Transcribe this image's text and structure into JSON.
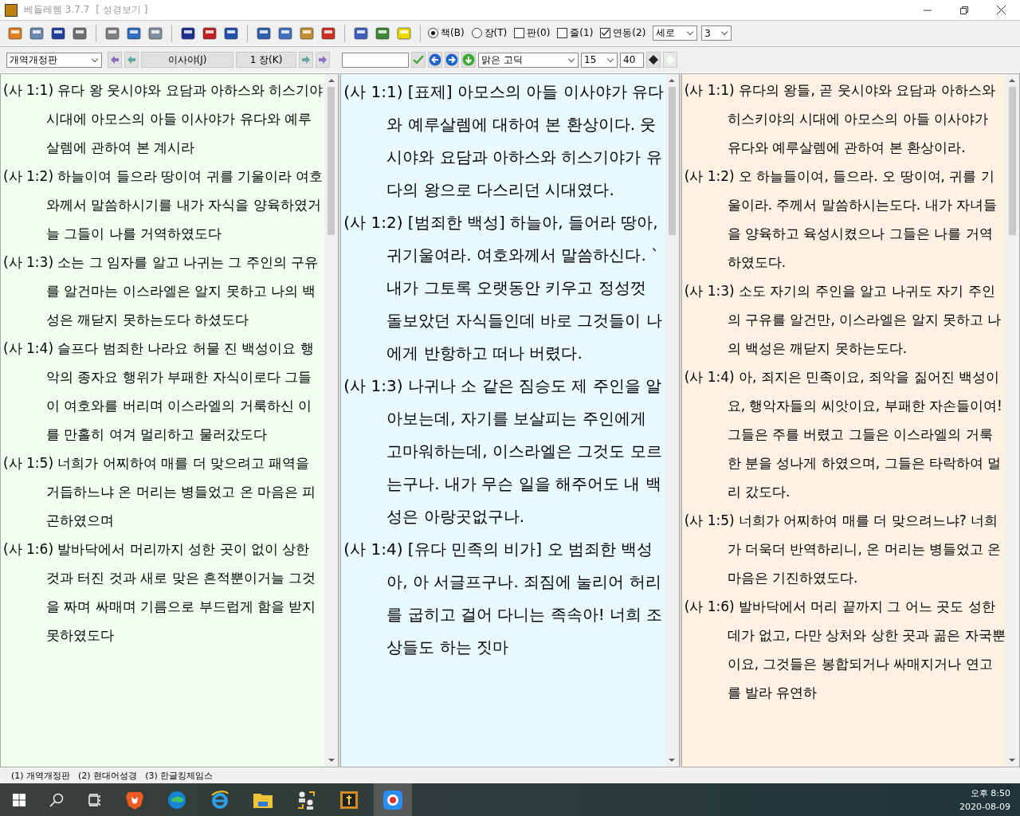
{
  "window": {
    "title": "베들레헴 3.7.7",
    "subtitle": "[ 성경보기 ]"
  },
  "toolbar": {
    "options": [
      {
        "kind": "radio",
        "label": "책(B)",
        "selected": true
      },
      {
        "kind": "radio",
        "label": "장(T)",
        "selected": false
      },
      {
        "kind": "checkbox",
        "label": "판(0)",
        "checked": false
      },
      {
        "kind": "checkbox",
        "label": "줄(1)",
        "checked": false
      },
      {
        "kind": "checkbox",
        "label": "연동(2)",
        "checked": true
      }
    ],
    "layout_select": "세로",
    "count_select": "3"
  },
  "navbar": {
    "version_select": "개역개정판",
    "book_button": "이사야(J)",
    "chapter_button": "1 장(K)",
    "font_select": "맑은 고딕",
    "size_select": "15",
    "width_value": "40"
  },
  "panes": [
    {
      "verses": [
        {
          "ref": "(사 1:1)",
          "text": "유다 왕 웃시야와 요담과 아하스와 히스기야 시대에 아모스의 아들 이사야가 유다와 예루살렘에 관하여 본 계시라"
        },
        {
          "ref": "(사 1:2)",
          "text": "하늘이여 들으라 땅이여 귀를 기울이라 여호와께서 말씀하시기를 내가 자식을 양육하였거늘 그들이 나를 거역하였도다"
        },
        {
          "ref": "(사 1:3)",
          "text": "소는 그 임자를 알고 나귀는 그 주인의 구유를 알건마는 이스라엘은 알지 못하고 나의 백성은 깨닫지 못하는도다 하셨도다"
        },
        {
          "ref": "(사 1:4)",
          "text": "슬프다 범죄한 나라요 허물 진 백성이요 행악의 종자요 행위가 부패한 자식이로다 그들이 여호와를 버리며 이스라엘의 거룩하신 이를 만홀히 여겨 멀리하고 물러갔도다"
        },
        {
          "ref": "(사 1:5)",
          "text": "너희가 어찌하여 매를 더 맞으려고 패역을 거듭하느냐 온 머리는 병들었고 온 마음은 피곤하였으며"
        },
        {
          "ref": "(사 1:6)",
          "text": "발바닥에서 머리까지 성한 곳이 없이 상한 것과 터진 것과 새로 맞은 흔적뿐이거늘 그것을 짜며 싸매며 기름으로 부드럽게 함을 받지 못하였도다"
        }
      ]
    },
    {
      "verses": [
        {
          "ref": "(사 1:1)",
          "text": "[표제] 아모스의 아들 이사야가 유다와 예루살렘에 대하여 본 환상이다. 웃시야와 요담과 아하스와 히스기야가 유다의 왕으로 다스리던 시대였다."
        },
        {
          "ref": "(사 1:2)",
          "text": "[범죄한 백성] 하늘아, 들어라 땅아, 귀기울여라. 여호와께서 말씀하신다. `내가 그토록 오랫동안 키우고 정성껏 돌보았던 자식들인데 바로 그것들이 나에게 반항하고 떠나 버렸다."
        },
        {
          "ref": "(사 1:3)",
          "text": "나귀나 소 같은 짐승도 제 주인을 알아보는데, 자기를 보살피는 주인에게 고마워하는데, 이스라엘은 그것도 모르는구나. 내가 무슨 일을 해주어도 내 백성은 아랑곳없구나."
        },
        {
          "ref": "(사 1:4)",
          "text": "[유다 민족의 비가] 오 범죄한 백성아, 아 서글프구나. 죄짐에 눌리어 허리를 굽히고 걸어 다니는 족속아! 너희 조상들도 하는 짓마"
        }
      ]
    },
    {
      "verses": [
        {
          "ref": "(사 1:1)",
          "text": "유다의 왕들, 곧 웃시야와 요담과 아하스와 히스키야의 시대에 아모스의 아들 이사야가 유다와 예루살렘에 관하여 본 환상이라."
        },
        {
          "ref": "(사 1:2)",
          "text": "오 하늘들이여, 들으라. 오 땅이여, 귀를 기울이라. 주께서 말씀하시는도다. 내가 자녀들을 양육하고 육성시켰으나 그들은 나를 거역하였도다."
        },
        {
          "ref": "(사 1:3)",
          "text": "소도 자기의 주인을 알고 나귀도 자기 주인의 구유를 알건만, 이스라엘은 알지 못하고 나의 백성은 깨닫지 못하는도다."
        },
        {
          "ref": "(사 1:4)",
          "text": "아, 죄지은 민족이요, 죄악을 짊어진 백성이요, 행악자들의 씨앗이요, 부패한 자손들이여! 그들은 주를 버렸고 그들은 이스라엘의 거룩한 분을 성나게 하였으며, 그들은 타락하여 멀리 갔도다."
        },
        {
          "ref": "(사 1:5)",
          "text": "너희가 어찌하여 매를 더 맞으려느냐? 너희가 더욱더 반역하리니, 온 머리는 병들었고 온 마음은 기진하였도다."
        },
        {
          "ref": "(사 1:6)",
          "text": "발바닥에서 머리 끝까지 그 어느 곳도 성한 데가 없고, 다만 상처와 상한 곳과 곪은 자국뿐이요, 그것들은 봉합되거나 싸매지거나 연고를 발라 유연하"
        }
      ]
    }
  ],
  "status_bar": [
    "(1) 개역개정판",
    "(2) 현대어성경",
    "(3) 한글킹제임스"
  ],
  "taskbar": {
    "time": "오후 8:50",
    "date": "2020-08-09"
  }
}
